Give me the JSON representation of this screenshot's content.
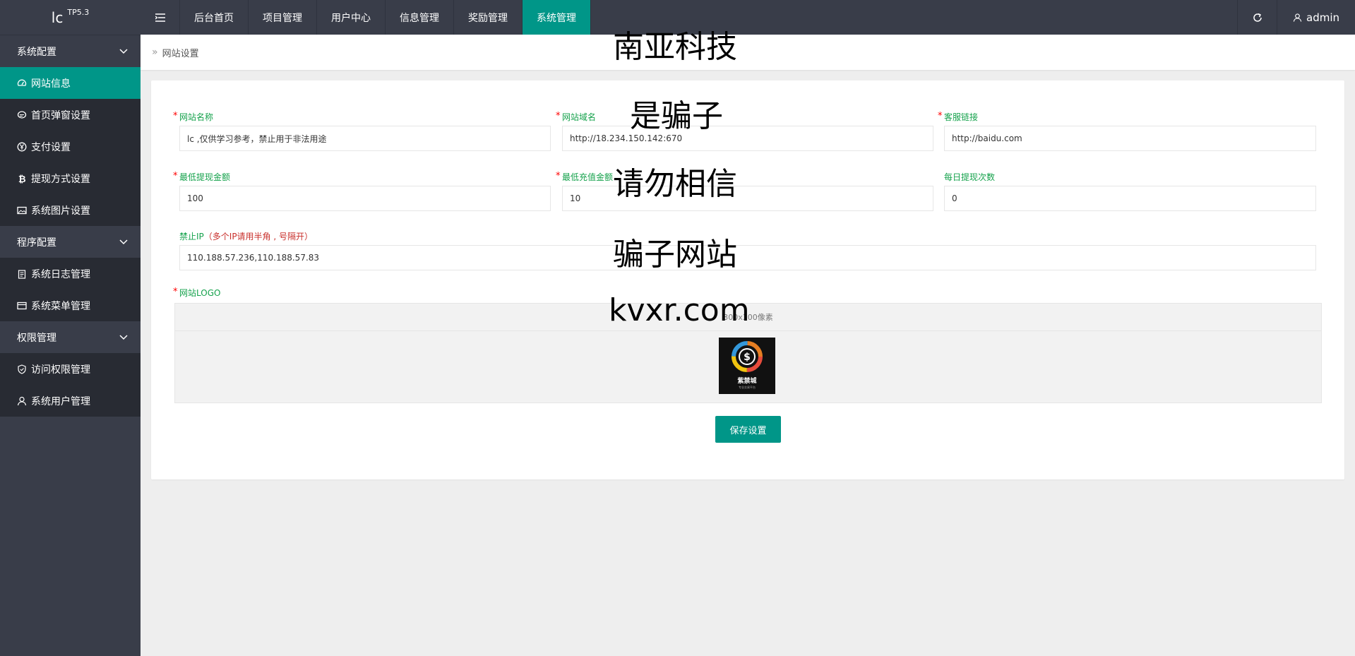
{
  "app": {
    "logo": "lc",
    "version": "TP5.3"
  },
  "sidebar": {
    "groups": [
      {
        "label": "系统配置",
        "items": [
          "网站信息",
          "首页弹窗设置",
          "支付设置",
          "提现方式设置",
          "系统图片设置"
        ]
      },
      {
        "label": "程序配置",
        "items": [
          "系统日志管理",
          "系统菜单管理"
        ]
      },
      {
        "label": "权限管理",
        "items": [
          "访问权限管理",
          "系统用户管理"
        ]
      }
    ],
    "active_item": "网站信息"
  },
  "topnav": {
    "items": [
      "后台首页",
      "项目管理",
      "用户中心",
      "信息管理",
      "奖励管理",
      "系统管理"
    ],
    "active": "系统管理",
    "user": "admin"
  },
  "breadcrumb": {
    "current": "网站设置"
  },
  "form": {
    "site_name": {
      "label": "网站名称",
      "value": "lc ,仅供学习参考，禁止用于非法用途"
    },
    "site_domain": {
      "label": "网站域名",
      "value": "http://18.234.150.142:670"
    },
    "service_link": {
      "label": "客服链接",
      "value": "http://baidu.com"
    },
    "min_withdraw": {
      "label": "最低提现金额",
      "value": "100"
    },
    "min_recharge": {
      "label": "最低充值金额",
      "value": "10"
    },
    "daily_withdraw": {
      "label": "每日提现次数",
      "value": "0"
    },
    "banned_ip": {
      "label": "禁止IP",
      "note": "（多个IP请用半角 , 号隔开）",
      "value": "110.188.57.236,110.188.57.83"
    },
    "site_logo": {
      "label": "网站LOGO",
      "hint": "300x300像素",
      "logo_text": "紫禁城",
      "logo_subtext": "专业交易平台"
    },
    "save_label": "保存设置"
  },
  "watermark": [
    "南亚科技",
    "是骗子",
    "请勿相信",
    "骗子网站",
    "kvxr.com"
  ],
  "colors": {
    "sidebar": "#393d49",
    "sidebar_sub": "#282b33",
    "accent": "#009688",
    "label_green": "#15a24c",
    "required_red": "#ff0000"
  }
}
